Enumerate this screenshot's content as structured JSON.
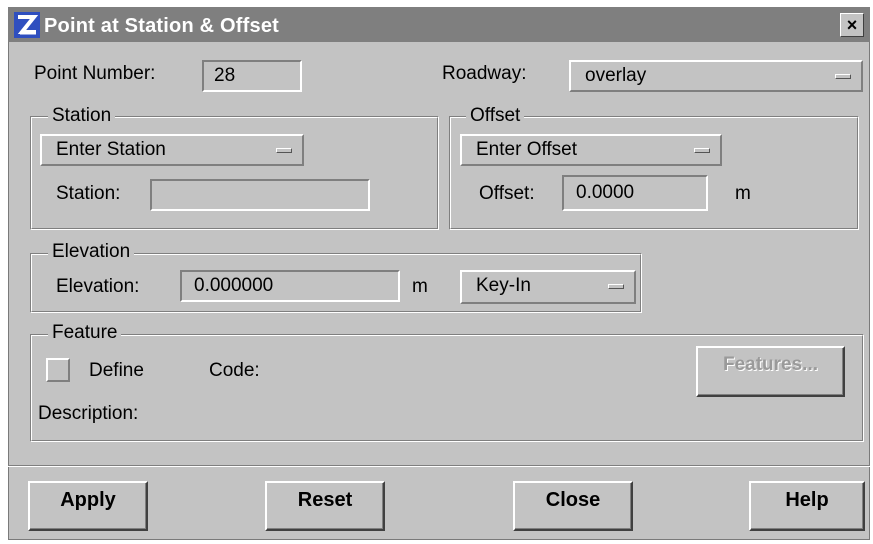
{
  "window": {
    "title": "Point at Station & Offset",
    "close_glyph": "×"
  },
  "point_number": {
    "label": "Point Number:",
    "value": "28"
  },
  "roadway": {
    "label": "Roadway:",
    "value": "overlay"
  },
  "station_group": {
    "legend": "Station",
    "mode": "Enter Station",
    "label": "Station:",
    "value": ""
  },
  "offset_group": {
    "legend": "Offset",
    "mode": "Enter Offset",
    "label": "Offset:",
    "value": "0.0000",
    "unit": "m"
  },
  "elevation_group": {
    "legend": "Elevation",
    "label": "Elevation:",
    "value": "0.000000",
    "unit": "m",
    "mode": "Key-In"
  },
  "feature_group": {
    "legend": "Feature",
    "define_label": "Define",
    "define_checked": false,
    "code_label": "Code:",
    "description_label": "Description:",
    "features_button": "Features..."
  },
  "buttons": {
    "apply": "Apply",
    "reset": "Reset",
    "close": "Close",
    "help": "Help"
  },
  "colors": {
    "dialog_bg": "#c3c3c3",
    "titlebar_bg": "#7f7f7f",
    "title_text": "#ffffff"
  }
}
